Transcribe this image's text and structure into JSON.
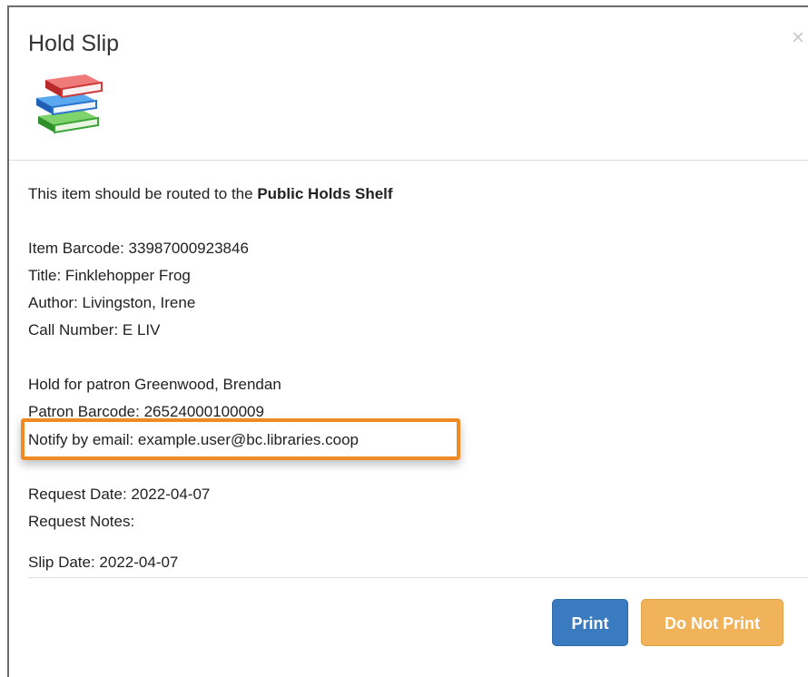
{
  "dialog": {
    "title": "Hold Slip",
    "close_glyph": "×",
    "icon": "books-stack-icon"
  },
  "slip": {
    "routing_prefix": "This item should be routed to the ",
    "routing_destination": "Public Holds Shelf",
    "item_barcode": "Item Barcode: 33987000923846",
    "title": "Title: Finklehopper Frog",
    "author": "Author: Livingston, Irene",
    "call_number": "Call Number:  E LIV",
    "hold_for": "Hold for patron Greenwood, Brendan",
    "patron_barcode": "Patron Barcode: 26524000100009",
    "notify": "Notify by email: example.user@bc.libraries.coop",
    "request_date": "Request Date: 2022-04-07",
    "request_notes": "Request Notes:",
    "slip_date": "Slip Date: 2022-04-07"
  },
  "buttons": {
    "print": "Print",
    "do_not_print": "Do Not Print"
  },
  "colors": {
    "highlight": "#f08a24",
    "print_button": "#3a7bc0",
    "do_not_print_button": "#f0b35a"
  }
}
